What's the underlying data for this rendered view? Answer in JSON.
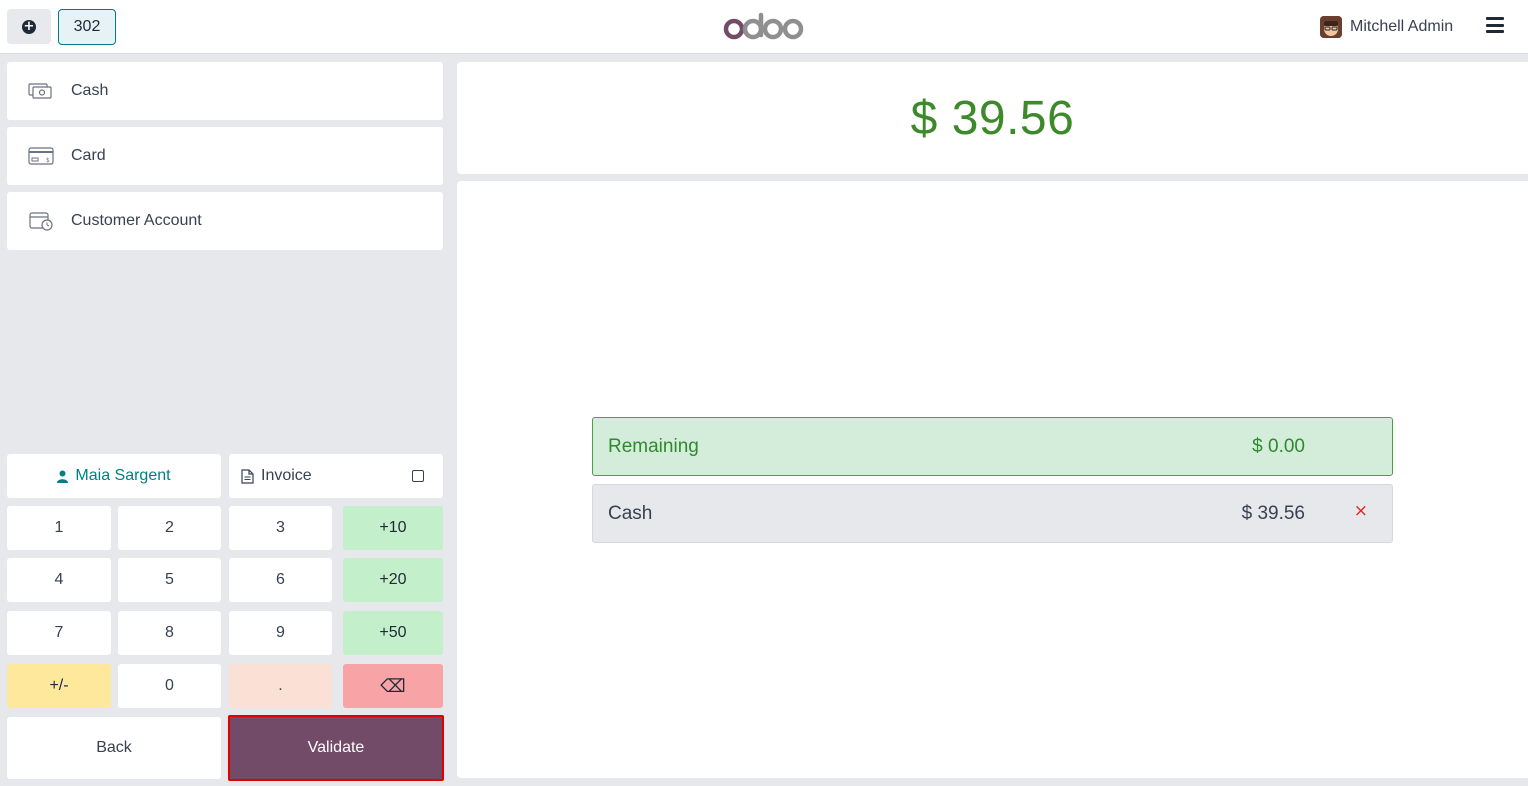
{
  "header": {
    "order_number": "302",
    "brand": "odoo",
    "user_name": "Mitchell Admin"
  },
  "payment_methods": [
    {
      "label": "Cash",
      "icon": "cash-icon"
    },
    {
      "label": "Card",
      "icon": "card-icon"
    },
    {
      "label": "Customer Account",
      "icon": "customer-account-icon"
    }
  ],
  "customer": {
    "name": "Maia Sargent"
  },
  "invoice": {
    "label": "Invoice",
    "checked": false
  },
  "numpad": {
    "k1": "1",
    "k2": "2",
    "k3": "3",
    "plus10": "+10",
    "k4": "4",
    "k5": "5",
    "k6": "6",
    "plus20": "+20",
    "k7": "7",
    "k8": "8",
    "k9": "9",
    "plus50": "+50",
    "sign": "+/-",
    "k0": "0",
    "dot": ".",
    "backspace": "⌫"
  },
  "actions": {
    "back": "Back",
    "validate": "Validate"
  },
  "summary": {
    "total": "$ 39.56",
    "remaining_label": "Remaining",
    "remaining_value": "$ 0.00",
    "lines": [
      {
        "method": "Cash",
        "amount": "$ 39.56",
        "delete": "×"
      }
    ]
  },
  "colors": {
    "brand": "#714b67",
    "accent": "#017e84",
    "total": "#3d8a2a",
    "remaining_bg": "#d4edda",
    "delete": "#dc2626"
  }
}
